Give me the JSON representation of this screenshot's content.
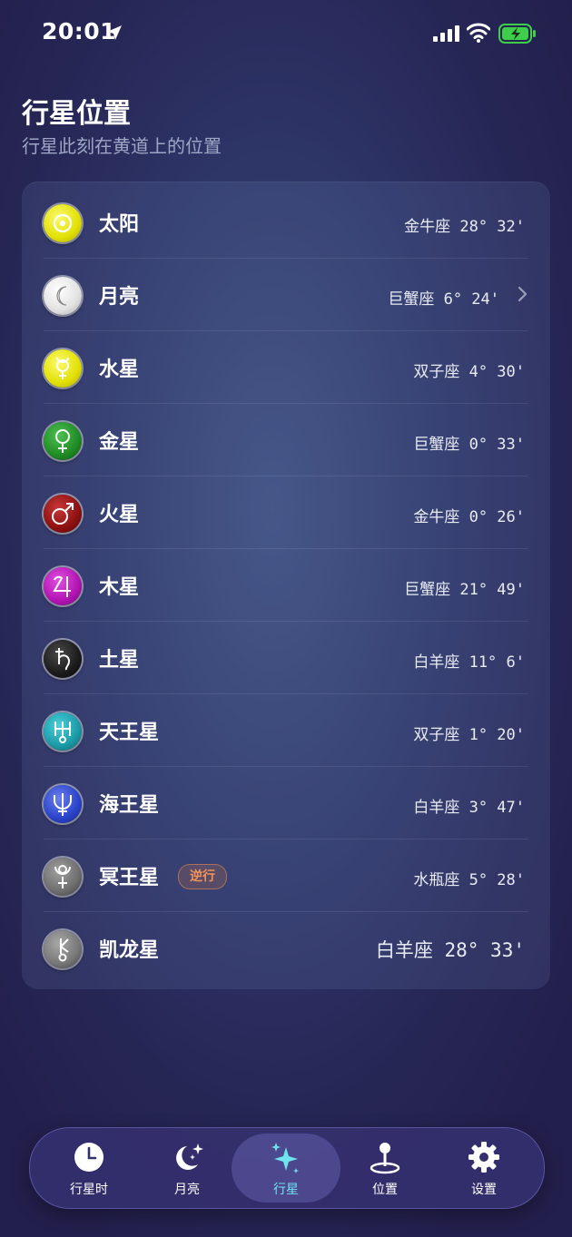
{
  "status_bar": {
    "time": "20:01"
  },
  "header": {
    "title": "行星位置",
    "subtitle": "行星此刻在黄道上的位置"
  },
  "planets": [
    {
      "name": "太阳",
      "position": "金牛座 28° 32'",
      "icon": "sun-icon",
      "color": "#e8e60a"
    },
    {
      "name": "月亮",
      "position": "巨蟹座 6° 24'",
      "icon": "moon-icon",
      "color": "#e6e6e6",
      "chevron": true
    },
    {
      "name": "水星",
      "position": "双子座 4° 30'",
      "icon": "mercury-icon",
      "color": "#e5e40c"
    },
    {
      "name": "金星",
      "position": "巨蟹座 0° 33'",
      "icon": "venus-icon",
      "color": "#1f8a24"
    },
    {
      "name": "火星",
      "position": "金牛座 0° 26'",
      "icon": "mars-icon",
      "color": "#8d1010"
    },
    {
      "name": "木星",
      "position": "巨蟹座 21° 49'",
      "icon": "jupiter-icon",
      "color": "#b213b2"
    },
    {
      "name": "土星",
      "position": "白羊座 11° 6'",
      "icon": "saturn-icon",
      "color": "#1b1b1b"
    },
    {
      "name": "天王星",
      "position": "双子座 1° 20'",
      "icon": "uranus-icon",
      "color": "#1a9aa6"
    },
    {
      "name": "海王星",
      "position": "白羊座 3° 47'",
      "icon": "neptune-icon",
      "color": "#2a42c8"
    },
    {
      "name": "冥王星",
      "position": "水瓶座 5° 28'",
      "icon": "pluto-icon",
      "color": "#6e6e6e",
      "badge": "逆行"
    },
    {
      "name": "凯龙星",
      "position": "白羊座 28° 33'",
      "icon": "chiron-icon",
      "color": "#777777"
    }
  ],
  "tabs": [
    {
      "label": "行星时",
      "icon": "clock-icon"
    },
    {
      "label": "月亮",
      "icon": "moon-stars-icon"
    },
    {
      "label": "行星",
      "icon": "sparkles-icon",
      "active": true
    },
    {
      "label": "位置",
      "icon": "location-pin-icon"
    },
    {
      "label": "设置",
      "icon": "gear-icon"
    }
  ],
  "colors": {
    "accent": "#6fe3ee",
    "badge": "#f0925a",
    "battery": "#3ecf4a"
  }
}
